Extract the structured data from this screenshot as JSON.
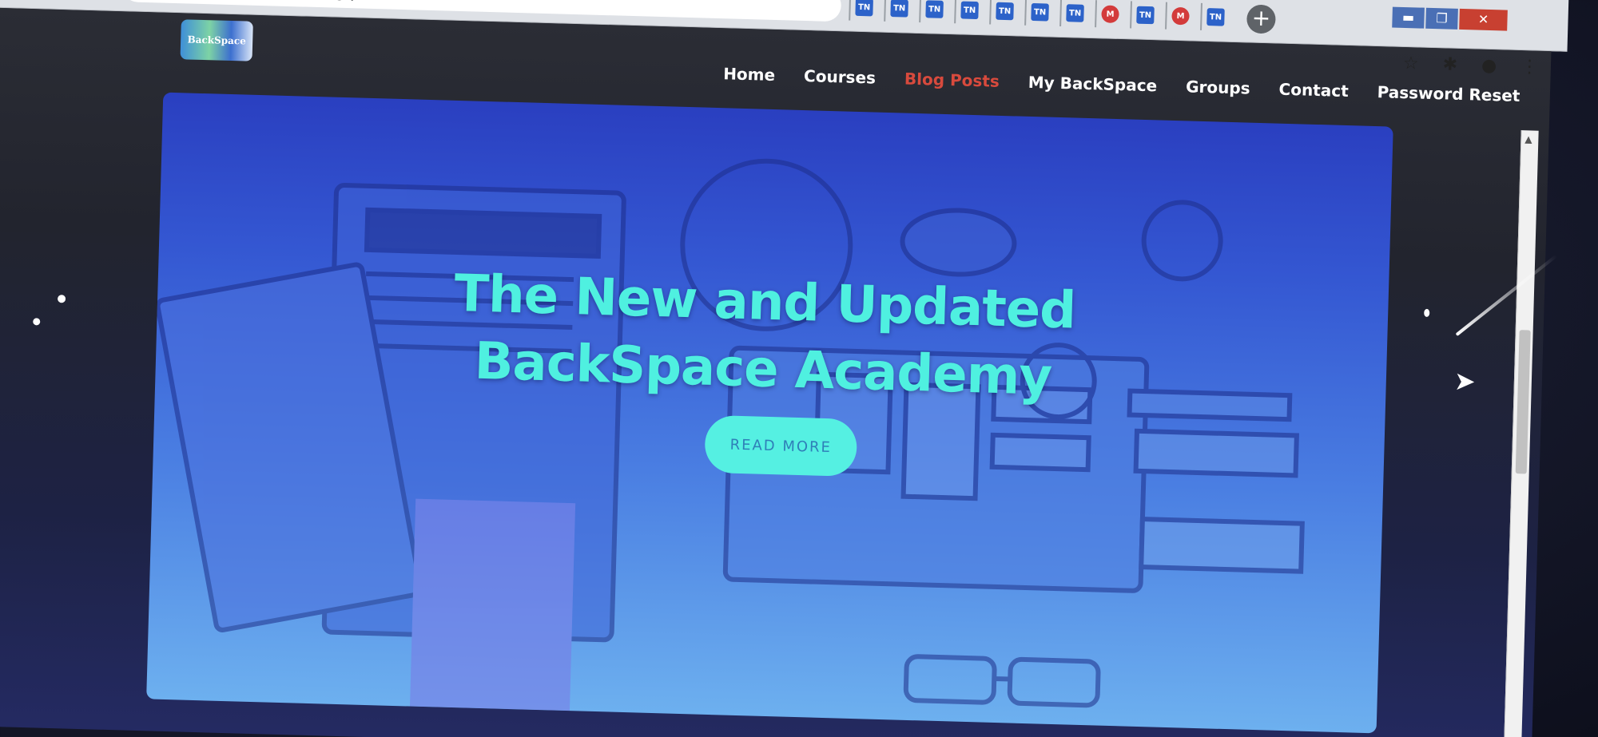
{
  "browser": {
    "url": "backspace.academy/blog-posts/",
    "tab_icons": [
      "TN",
      "TN",
      "TN",
      "TN",
      "TN",
      "TN",
      "TN",
      "M",
      "TN",
      "M",
      "TN"
    ],
    "new_tab_label": "+",
    "window_buttons": {
      "minimize": "▬",
      "restore": "❐",
      "close": "✕"
    }
  },
  "toolbar": {
    "bookmark_icon": "star-icon",
    "extensions_icon": "puzzle-icon",
    "profile_icon": "profile-icon",
    "menu_icon": "kebab-menu-icon"
  },
  "site": {
    "logo_text": "BackSpace",
    "nav": [
      {
        "label": "Home"
      },
      {
        "label": "Courses"
      },
      {
        "label": "Blog Posts",
        "active": true
      },
      {
        "label": "My BackSpace"
      },
      {
        "label": "Groups"
      },
      {
        "label": "Contact"
      },
      {
        "label": "Password Reset"
      }
    ]
  },
  "hero": {
    "title": "The New and Updated BackSpace Academy",
    "button_label": "READ MORE"
  },
  "colors": {
    "accent_cyan": "#4ff0e0",
    "nav_active": "#d84a3d",
    "hero_blue": "#3457d2"
  }
}
